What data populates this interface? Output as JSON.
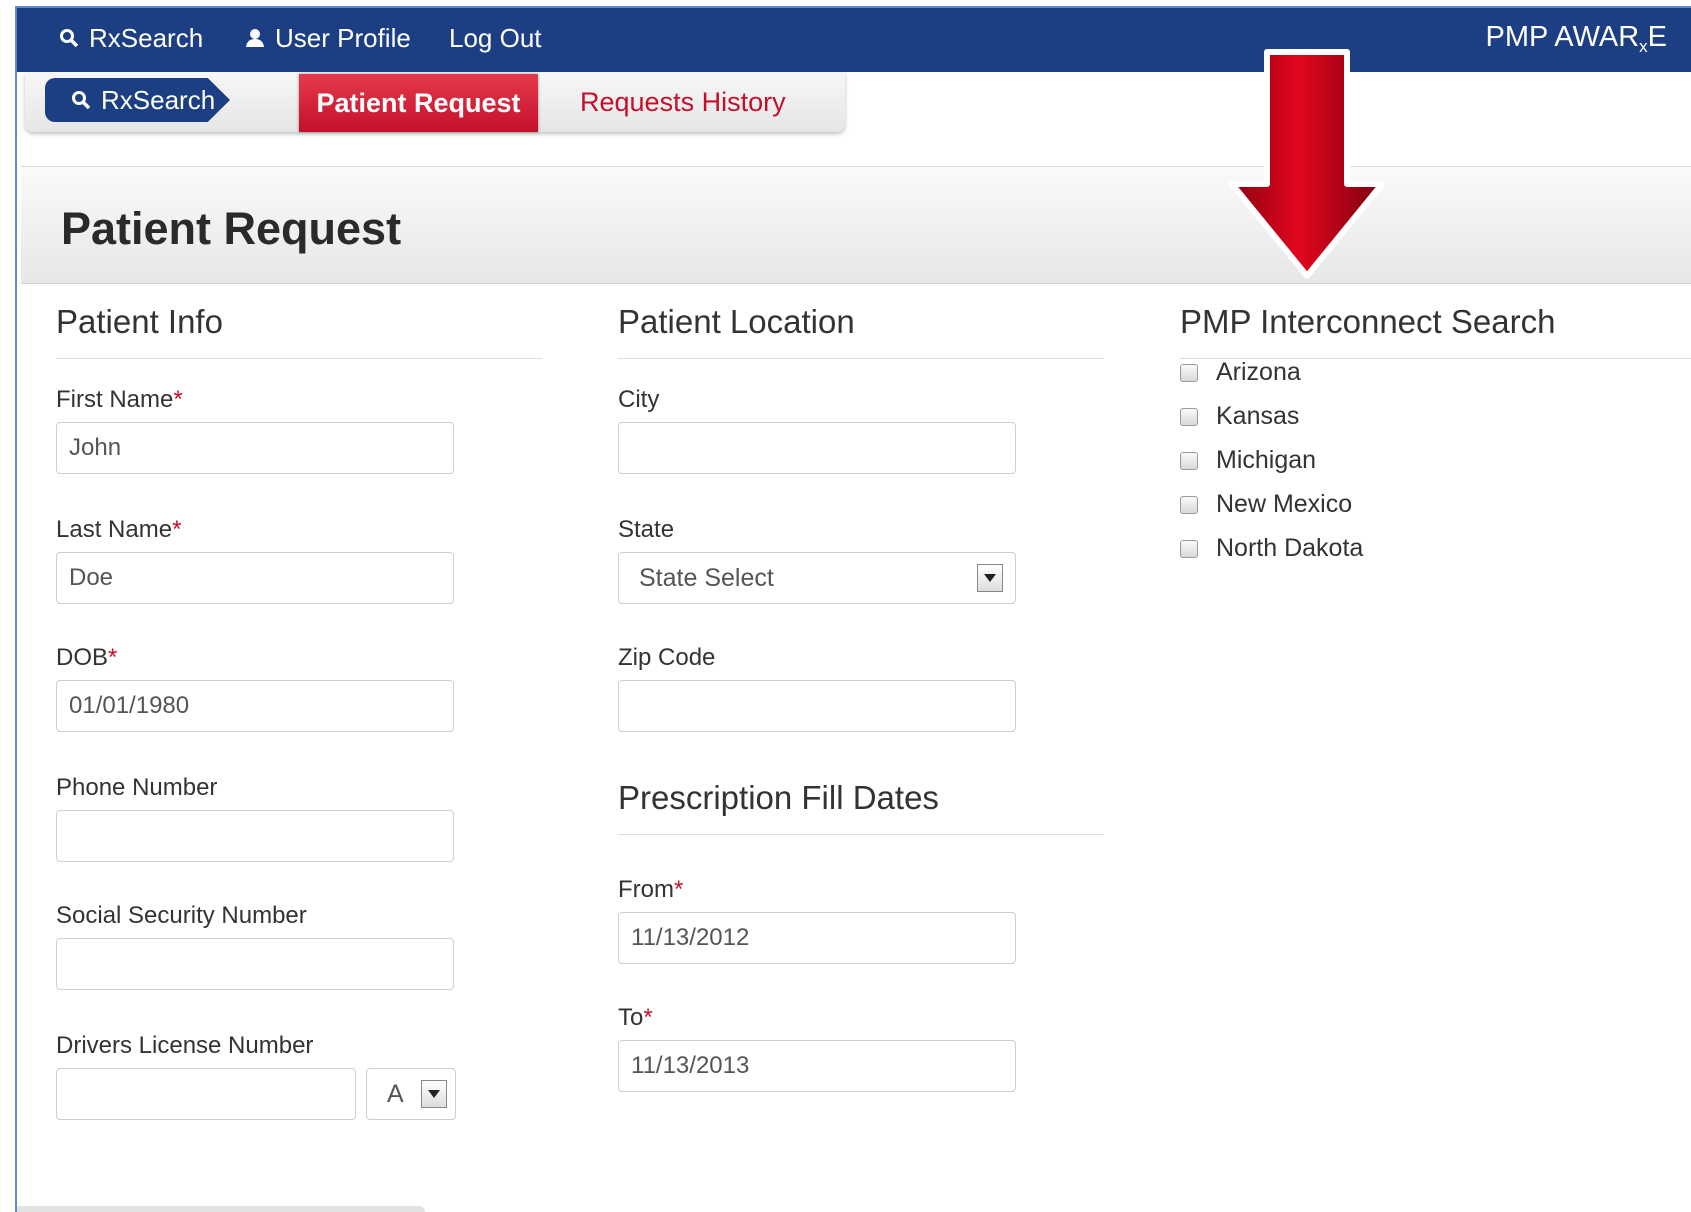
{
  "topnav": {
    "rxsearch": "RxSearch",
    "user_profile": "User Profile",
    "log_out": "Log Out",
    "brand_main": "PMP AWAR",
    "brand_sub": "x",
    "brand_end": "E"
  },
  "subnav": {
    "crumb": "RxSearch",
    "tabs": [
      "Patient Request",
      "Requests History"
    ],
    "active_tab": "Patient Request"
  },
  "page": {
    "title": "Patient Request"
  },
  "patient_info": {
    "heading": "Patient Info",
    "first_name_label": "First Name",
    "first_name_value": "John",
    "last_name_label": "Last Name",
    "last_name_value": "Doe",
    "dob_label": "DOB",
    "dob_value": "01/01/1980",
    "phone_label": "Phone Number",
    "phone_value": "",
    "ssn_label": "Social Security Number",
    "ssn_value": "",
    "dl_label": "Drivers License Number",
    "dl_value": "",
    "dl_state_value": "A",
    "required_mark": "*"
  },
  "patient_location": {
    "heading": "Patient Location",
    "city_label": "City",
    "city_value": "",
    "state_label": "State",
    "state_value": "State Select",
    "zip_label": "Zip Code",
    "zip_value": ""
  },
  "fill_dates": {
    "heading": "Prescription Fill Dates",
    "from_label": "From",
    "from_value": "11/13/2012",
    "to_label": "To",
    "to_value": "11/13/2013"
  },
  "interconnect": {
    "heading": "PMP Interconnect Search",
    "states": [
      "Arizona",
      "Kansas",
      "Michigan",
      "New Mexico",
      "North Dakota"
    ]
  },
  "colors": {
    "nav_blue": "#1c3f84",
    "accent_red": "#c4102a",
    "frame_blue": "#5b8ad0"
  }
}
